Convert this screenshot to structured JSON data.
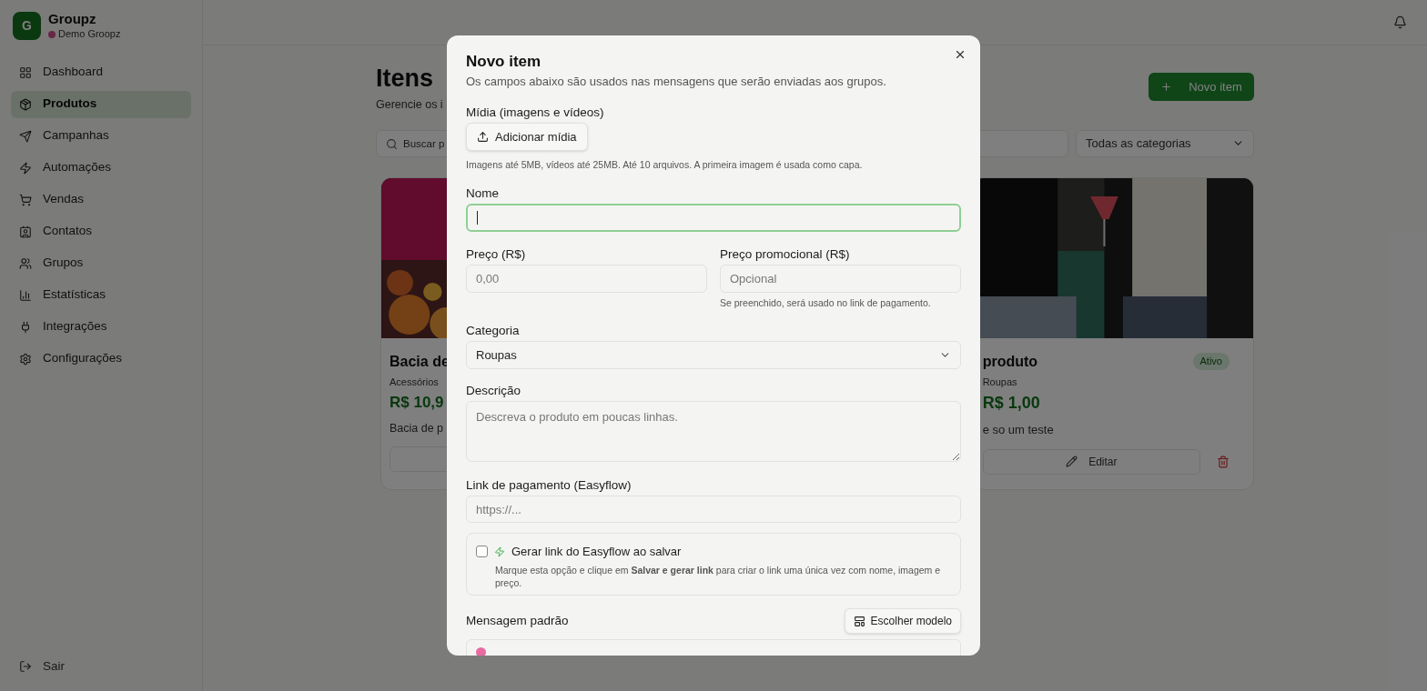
{
  "app": {
    "logo_letter": "G",
    "name": "Groupz",
    "workspace": "Demo Groopz"
  },
  "sidebar": {
    "items": [
      {
        "label": "Dashboard",
        "selected": false
      },
      {
        "label": "Produtos",
        "selected": true
      },
      {
        "label": "Campanhas",
        "selected": false
      },
      {
        "label": "Automações",
        "selected": false
      },
      {
        "label": "Vendas",
        "selected": false
      },
      {
        "label": "Contatos",
        "selected": false
      },
      {
        "label": "Grupos",
        "selected": false
      },
      {
        "label": "Estatísticas",
        "selected": false
      },
      {
        "label": "Integrações",
        "selected": false
      },
      {
        "label": "Configurações",
        "selected": false
      }
    ],
    "logout": "Sair"
  },
  "page": {
    "title": "Itens",
    "subtitle": "Gerencie os i",
    "new_button": "Novo item",
    "search": {
      "placeholder": "Buscar p"
    },
    "category_filter": "Todas as categorias"
  },
  "cards": [
    {
      "title": "Bacia de",
      "category": "Acessórios",
      "price": "R$ 10,9",
      "description": "Bacia de p"
    },
    {
      "title": "produto",
      "status": "Ativo",
      "category": "Roupas",
      "price": "R$ 1,00",
      "description": "e so um teste",
      "edit_button": "Editar"
    }
  ],
  "modal": {
    "title": "Novo item",
    "description": "Os campos abaixo são usados nas mensagens que serão enviadas aos grupos.",
    "media": {
      "label": "Mídia (imagens e vídeos)",
      "button": "Adicionar mídia",
      "hint": "Imagens até 5MB, vídeos até 25MB. Até 10 arquivos. A primeira imagem é usada como capa."
    },
    "name": {
      "label": "Nome",
      "focused": true
    },
    "price": {
      "label": "Preço (R$)",
      "placeholder": "0,00"
    },
    "promo_price": {
      "label": "Preço promocional (R$)",
      "placeholder": "Opcional",
      "hint": "Se preenchido, será usado no link de pagamento."
    },
    "category": {
      "label": "Categoria",
      "value": "Roupas"
    },
    "description_field": {
      "label": "Descrição",
      "placeholder": "Descreva o produto em poucas linhas."
    },
    "payment_link": {
      "label": "Link de pagamento (Easyflow)",
      "placeholder": "https://..."
    },
    "generate_link": {
      "label": "Gerar link do Easyflow ao salvar",
      "checked": false,
      "hint": "Marque esta opção e clique em **Salvar e gerar link** para criar o link uma única vez com nome, imagem e preço."
    },
    "message": {
      "label": "Mensagem padrão",
      "button": "Escolher modelo"
    }
  }
}
